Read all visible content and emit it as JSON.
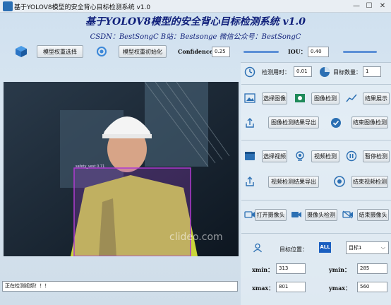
{
  "window": {
    "title": "基于YOLOV8模型的安全背心目标检测系统 v1.0",
    "minimize": "—",
    "maximize": "☐",
    "close": "✕"
  },
  "header": {
    "title": "基于YOLOV8模型的安全背心目标检测系统 v1.0",
    "subtitle": "CSDN：BestSongC   B站：Bestsonge   微信公众号：BestSongC"
  },
  "toolbar": {
    "model_select": "模型权重选择",
    "model_init": "模型权重初始化",
    "confidence_label": "Confidence",
    "confidence_value": "0.25",
    "iou_label": "IOU：",
    "iou_value": "0.40"
  },
  "video": {
    "watermark": "clideo.com",
    "detection_label": "safety_vest 0.71",
    "confidence_level": 0.25,
    "iou_level": 0.4
  },
  "stats": {
    "time_label": "检测用时：",
    "time_value": "0.01",
    "count_label": "目标数量：",
    "count_value": "1"
  },
  "image_section": {
    "select": "选择图像",
    "detect": "图像检测",
    "show": "结果展示",
    "export": "图像检测结果导出",
    "end": "结束图像检测"
  },
  "video_section": {
    "select": "选择视频",
    "detect": "视频检测",
    "pause": "暂停检测",
    "export": "视频检测结果导出",
    "end": "结束视频检测"
  },
  "camera_section": {
    "open": "打开摄像头",
    "detect": "摄像头检测",
    "end": "结束摄像头"
  },
  "target": {
    "position_label": "目标位置：",
    "all_badge": "ALL",
    "select_value": "目标1",
    "xmin_label": "xmin：",
    "xmin_value": "313",
    "ymin_label": "ymin：",
    "ymin_value": "285",
    "xmax_label": "xmax：",
    "xmax_value": "801",
    "ymax_label": "ymax：",
    "ymax_value": "560"
  },
  "status": {
    "text": "正在检测视频！！！"
  },
  "colors": {
    "title_blue": "#0f1f7a",
    "accent": "#2b6fb3",
    "bbox": "#b03ad0"
  }
}
